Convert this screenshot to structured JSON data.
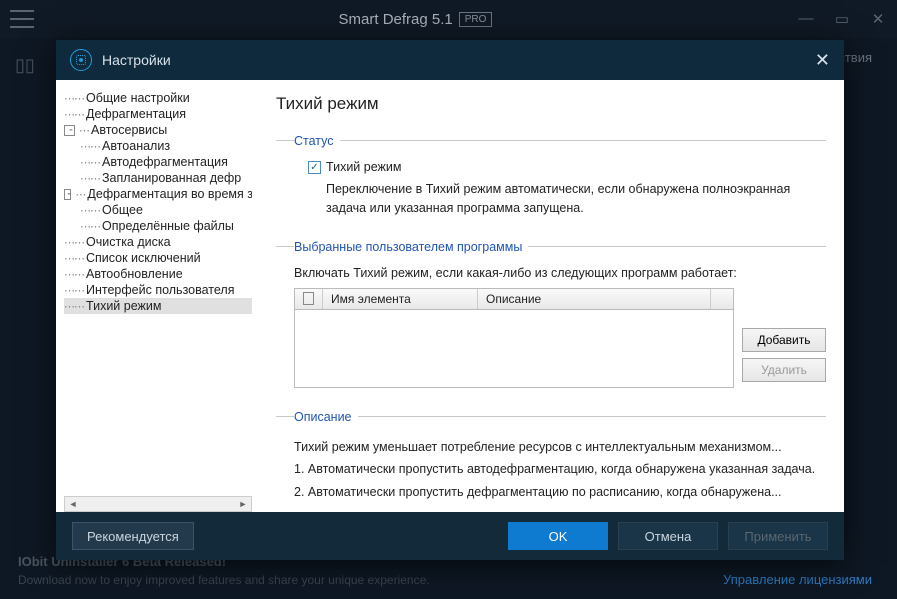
{
  "app": {
    "title": "Smart Defrag 5.1",
    "badge": "PRO",
    "bg_tab": "ствия",
    "promo_title": "IObit Uninstaller 6 Beta Released!",
    "promo_sub": "Download now to enjoy improved features and share your unique experience.",
    "license_link": "Управление лицензиями"
  },
  "modal": {
    "title": "Настройки",
    "page_title": "Тихий режим"
  },
  "tree": {
    "n0": "Общие настройки",
    "n1": "Дефрагментация",
    "n2": "Автосервисы",
    "n2a": "Автоанализ",
    "n2b": "Автодефрагментация",
    "n2c": "Запланированная дефр",
    "n3": "Дефрагментация во время з",
    "n3a": "Общее",
    "n3b": "Определённые файлы",
    "n4": "Очистка диска",
    "n5": "Список исключений",
    "n6": "Автообновление",
    "n7": "Интерфейс пользователя",
    "n8": "Тихий режим"
  },
  "status": {
    "legend": "Статус",
    "checkbox": "Тихий режим",
    "desc": "Переключение в Тихий режим автоматически, если обнаружена полноэкранная задача или указанная программа запущена."
  },
  "programs": {
    "legend": "Выбранные пользователем программы",
    "desc": "Включать Тихий режим, если какая-либо из следующих программ работает:",
    "col_name": "Имя элемента",
    "col_desc": "Описание",
    "btn_add": "Добавить",
    "btn_del": "Удалить"
  },
  "description": {
    "legend": "Описание",
    "line1": "Тихий режим уменьшает потребление ресурсов с интеллектуальным механизмом...",
    "line2": "1. Автоматически пропустить автодефрагментацию, когда обнаружена указанная задача.",
    "line3": "2. Автоматически пропустить дефрагментацию по расписанию, когда обнаружена..."
  },
  "footer": {
    "recommend": "Рекомендуется",
    "ok": "OK",
    "cancel": "Отмена",
    "apply": "Применить"
  }
}
